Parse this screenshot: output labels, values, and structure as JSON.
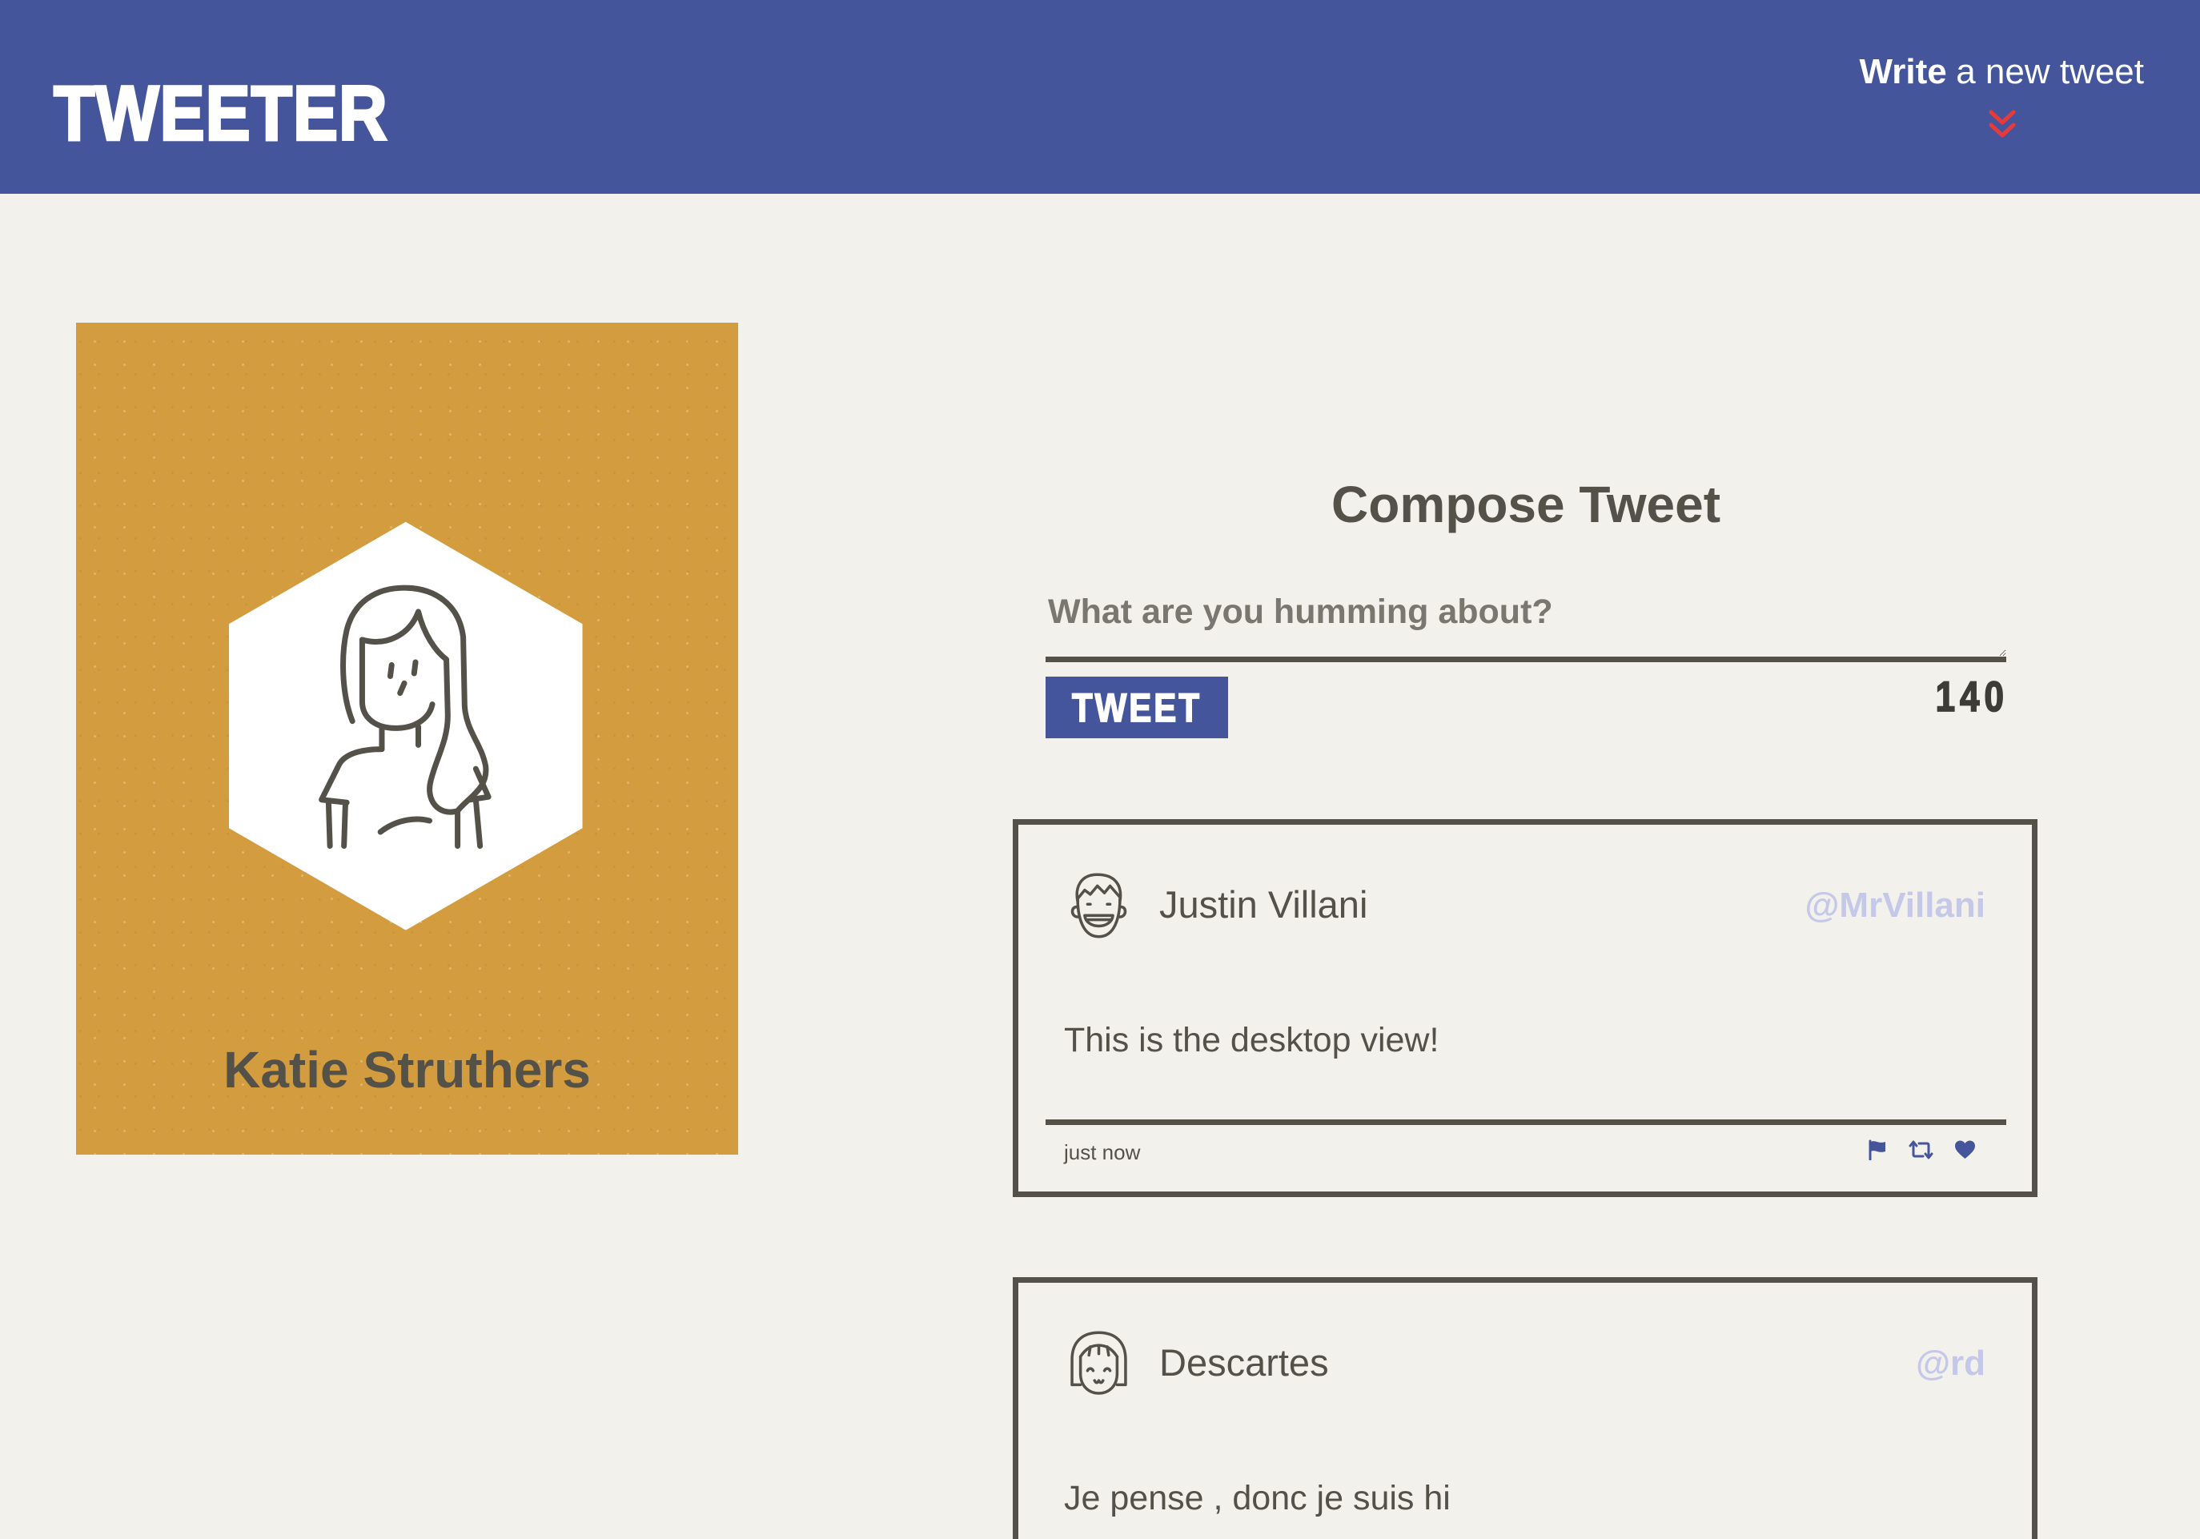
{
  "header": {
    "logo": "TWEETER",
    "compose_toggle": {
      "emphasis": "Write",
      "rest": "a new tweet",
      "icon": "double-chevron-down-icon"
    }
  },
  "profile": {
    "name": "Katie Struthers",
    "avatar_icon": "woman-avatar-icon"
  },
  "compose": {
    "title": "Compose Tweet",
    "placeholder": "What are you humming about?",
    "button_label": "TWEET",
    "char_counter": "140"
  },
  "tweets": [
    {
      "name": "Justin Villani",
      "handle": "@MrVillani",
      "content": "This is the desktop view!",
      "timestamp": "just now",
      "avatar_icon": "grinning-boy-avatar-icon",
      "actions": [
        "flag-icon",
        "retweet-icon",
        "heart-icon"
      ]
    },
    {
      "name": "Descartes",
      "handle": "@rd",
      "content": "Je pense , donc je suis hi",
      "avatar_icon": "smiling-girl-avatar-icon"
    }
  ],
  "colors": {
    "header_background": "#45559b",
    "page_background": "#f2f1ec",
    "profile_card": "#d39c3f",
    "text": "#545149",
    "handle": "#c5c8e8",
    "chevron": "#e63a3d",
    "action_icons": "#45559b",
    "tweet_button": "#45559b"
  }
}
